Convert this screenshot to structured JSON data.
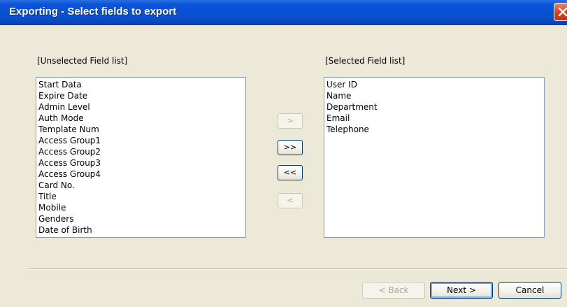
{
  "window": {
    "title": "Exporting - Select fields to export"
  },
  "unselected": {
    "caption": "[Unselected Field list]",
    "items": [
      "Start Data",
      "Expire Date",
      "Admin Level",
      "Auth Mode",
      "Template Num",
      "Access Group1",
      "Access Group2",
      "Access Group3",
      "Access Group4",
      "Card No.",
      "Title",
      "Mobile",
      "Genders",
      "Date of Birth"
    ]
  },
  "selected": {
    "caption": "[Selected Field list]",
    "items": [
      "User ID",
      "Name",
      "Department",
      "Email",
      "Telephone"
    ]
  },
  "move_buttons": {
    "add_one": ">",
    "add_all": ">>",
    "remove_all": "<<",
    "remove_one": "<"
  },
  "footer": {
    "back": "< Back",
    "next": "Next >",
    "cancel": "Cancel"
  },
  "colors": {
    "titlebar": "#0851d0",
    "dialog_bg": "#ece9d8",
    "list_border": "#7f9db9"
  }
}
